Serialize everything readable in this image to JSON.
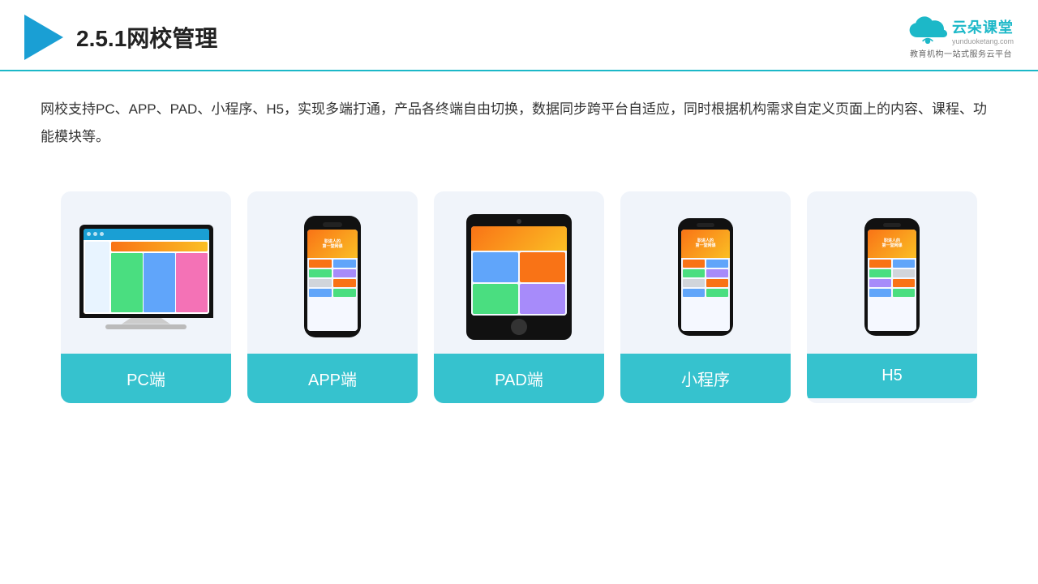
{
  "header": {
    "title": "2.5.1网校管理",
    "logo_text": "云朵课堂",
    "logo_url": "yunduoketang.com",
    "logo_slogan": "教育机构一站\n式服务云平台"
  },
  "description": "网校支持PC、APP、PAD、小程序、H5，实现多端打通，产品各终端自由切换，数据同步跨平台自适应，同时根据机构需求自定义页面上的内容、课程、功能模块等。",
  "cards": [
    {
      "label": "PC端",
      "device": "pc"
    },
    {
      "label": "APP端",
      "device": "mobile"
    },
    {
      "label": "PAD端",
      "device": "tablet"
    },
    {
      "label": "小程序",
      "device": "wechat"
    },
    {
      "label": "H5",
      "device": "h5"
    }
  ]
}
